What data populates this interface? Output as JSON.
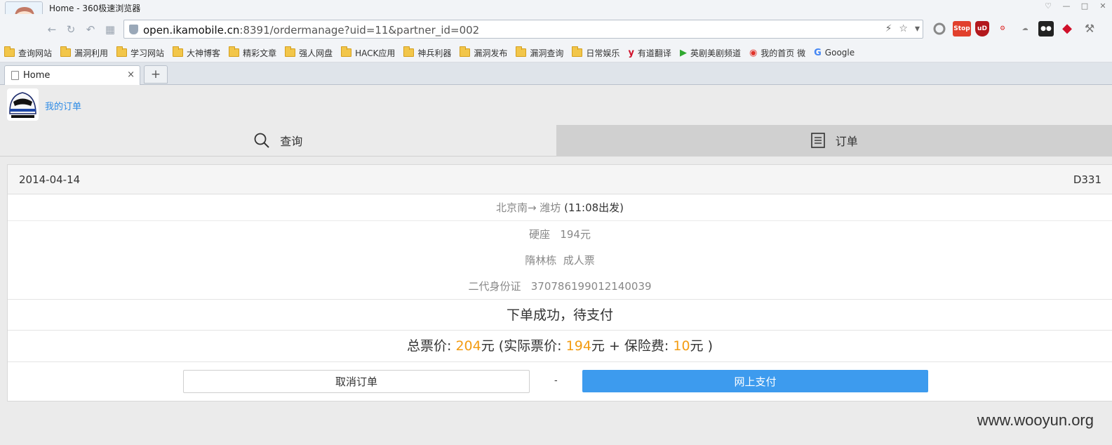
{
  "browser": {
    "window_title": "Home - 360极速浏览器",
    "url_host": "open.ikamobile.cn",
    "url_rest": ":8391/ordermanage?uid=11&partner_id=002",
    "extension_label": "Stop",
    "bookmarks": [
      {
        "label": "查询网站",
        "icon": "folder-icon"
      },
      {
        "label": "漏洞利用",
        "icon": "folder-icon"
      },
      {
        "label": "学习网站",
        "icon": "folder-icon"
      },
      {
        "label": "大神博客",
        "icon": "folder-icon"
      },
      {
        "label": "精彩文章",
        "icon": "folder-icon"
      },
      {
        "label": "强人网盘",
        "icon": "folder-icon"
      },
      {
        "label": "HACK应用",
        "icon": "folder-icon"
      },
      {
        "label": "神兵利器",
        "icon": "folder-icon"
      },
      {
        "label": "漏洞发布",
        "icon": "folder-icon"
      },
      {
        "label": "漏洞查询",
        "icon": "folder-icon"
      },
      {
        "label": "日常娱乐",
        "icon": "folder-icon"
      },
      {
        "label": "有道翻译",
        "icon": "youdao-icon"
      },
      {
        "label": "英剧美剧频道",
        "icon": "play-icon"
      },
      {
        "label": "我的首页 微",
        "icon": "weibo-icon"
      },
      {
        "label": "Google",
        "icon": "google-icon"
      }
    ],
    "tab": {
      "title": "Home",
      "close": "×"
    },
    "new_tab": "+"
  },
  "app": {
    "header_title": "我的订单",
    "tabs": {
      "query": "查询",
      "order": "订单"
    }
  },
  "order": {
    "date": "2014-04-14",
    "train_no": "D331",
    "route": "北京南→ 潍坊",
    "departure": "(11:08出发)",
    "seat": "硬座   194元",
    "passenger": "隋林栋  成人票",
    "id_card": "二代身份证   370786199012140039",
    "status": "下单成功，待支付",
    "price": {
      "total_label": "总票价: ",
      "total": "204",
      "unit": "元",
      "actual_label": " (实际票价: ",
      "actual": "194",
      "plus": "元 + 保险费: ",
      "insurance": "10",
      "end": "元 )"
    },
    "actions": {
      "cancel": "取消订单",
      "separator": "-",
      "pay": "网上支付"
    }
  },
  "watermark": "www.wooyun.org",
  "colors": {
    "accent_blue": "#3d9bee",
    "link_blue": "#2e8be6",
    "price_orange": "#f39c12"
  }
}
